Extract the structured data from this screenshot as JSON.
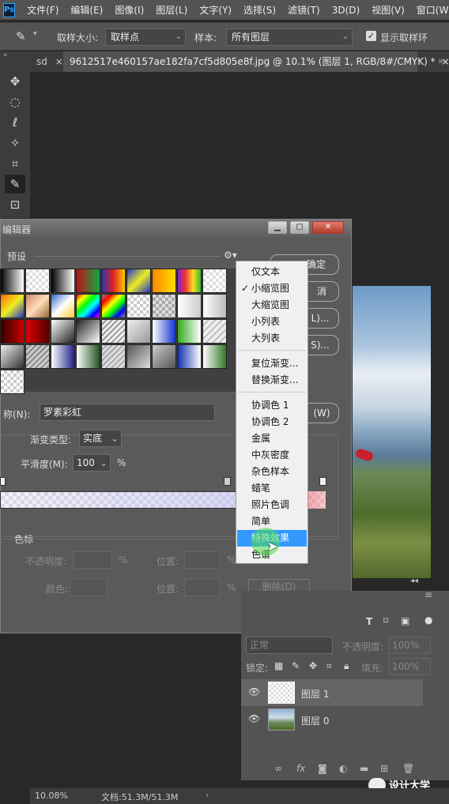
{
  "menubar": {
    "logo": "Ps",
    "items": [
      "文件(F)",
      "编辑(E)",
      "图像(I)",
      "图层(L)",
      "文字(Y)",
      "选择(S)",
      "滤镜(T)",
      "3D(D)",
      "视图(V)",
      "窗口(W)"
    ]
  },
  "options": {
    "sample_size_label": "取样大小:",
    "sample_size_value": "取样点",
    "sample_label": "样本:",
    "sample_value": "所有图层",
    "show_ring_label": "显示取样环"
  },
  "tabs": {
    "partial": "sd",
    "active": "9612517e460157ae182fa7cf5d805e8f.jpg @ 10.1% (图层 1, RGB/8#/CMYK) *"
  },
  "dialog": {
    "title": "编辑器",
    "presets_label": "预设",
    "ok_label": "确定",
    "cancel_label": "消",
    "load_label": "L)...",
    "save_label": "S)...",
    "new_label": "(W)",
    "name_label": "称(N):",
    "name_value": "罗素彩虹",
    "gradient_type_label": "渐变类型:",
    "gradient_type_value": "实底",
    "smoothness_label": "平滑度(M):",
    "smoothness_value": "100",
    "percent": "%",
    "stops_label": "色标",
    "opacity_label": "不透明度:",
    "location_label": "位置:",
    "color_label": "颜色:",
    "delete_label": "删除(D)"
  },
  "context_menu": {
    "items": [
      "仅文本",
      "小缩览图",
      "大缩览图",
      "小列表",
      "大列表",
      "复位渐变...",
      "替换渐变...",
      "协调色 1",
      "协调色 2",
      "金属",
      "中灰密度",
      "杂色样本",
      "蜡笔",
      "照片色调",
      "简单",
      "特殊效果",
      "色谱"
    ],
    "checked": "小缩览图",
    "highlighted": "特殊效果"
  },
  "layers": {
    "blend_mode": "正常",
    "opacity_label": "不透明度:",
    "opacity_value": "100%",
    "lock_label": "锁定:",
    "fill_label": "填充:",
    "fill_value": "100%",
    "rows": [
      {
        "name": "图层 1"
      },
      {
        "name": "图层 0"
      }
    ]
  },
  "status": {
    "zoom": "10.08%",
    "doc": "文档:51.3M/51.3M"
  },
  "watermark": "设计大学",
  "colors": {
    "accent": "#3399ff",
    "panel": "#535353",
    "dialog": "#5a5a5a"
  }
}
